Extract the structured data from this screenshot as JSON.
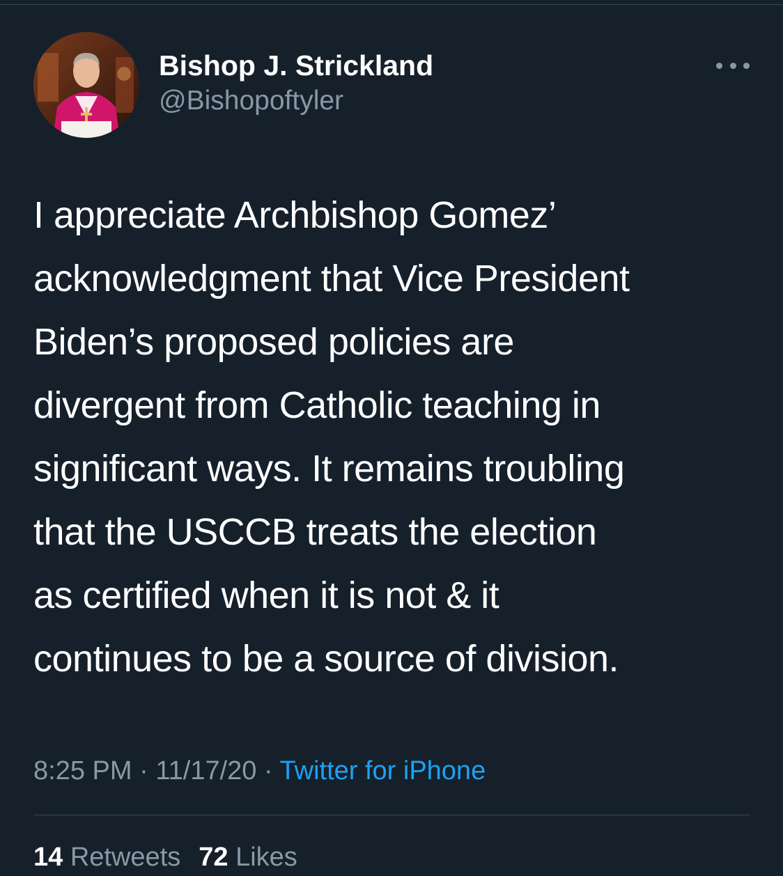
{
  "tweet": {
    "author": {
      "display_name": "Bishop J. Strickland",
      "handle": "@Bishopoftyler"
    },
    "more_icon": "more-horizontal-icon",
    "text_lines": [
      "I appreciate Archbishop Gomez’",
      "acknowledgment that Vice President",
      "Biden’s proposed policies are",
      "divergent from Catholic teaching in",
      "significant ways. It remains troubling",
      "that the USCCB treats the election",
      "as certified when it is not & it",
      "continues to be a source of division."
    ],
    "time": "8:25 PM",
    "separator": "·",
    "date": "11/17/20",
    "source": "Twitter for iPhone",
    "stats": {
      "retweets_count": "14",
      "retweets_label": "Retweets",
      "likes_count": "72",
      "likes_label": "Likes"
    }
  },
  "colors": {
    "background": "#15202b",
    "primary_text": "#ffffff",
    "secondary_text": "#8899a6",
    "link": "#1da1f2",
    "divider": "#38444d"
  }
}
